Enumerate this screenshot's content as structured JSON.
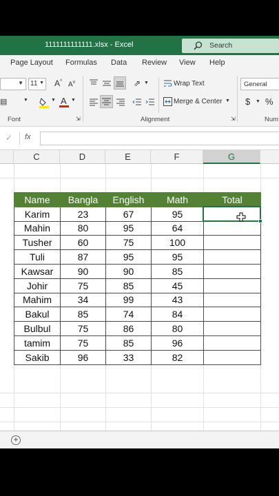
{
  "window": {
    "title": "1111111111111.xlsx  -  Excel"
  },
  "search": {
    "label": "Search"
  },
  "ribbon": {
    "menus": [
      "Page Layout",
      "Formulas",
      "Data",
      "Review",
      "View",
      "Help"
    ],
    "font_size": "11",
    "wrap_text": "Wrap Text",
    "merge_center": "Merge & Center",
    "number_format": "General",
    "currency": "$",
    "percent": "%",
    "groups": {
      "font": "Font",
      "alignment": "Alignment",
      "number": "Num"
    }
  },
  "formula_bar": {
    "fx": "fx",
    "value": ""
  },
  "columns": [
    "C",
    "D",
    "E",
    "F",
    "G"
  ],
  "selected_column": "G",
  "table": {
    "headers": [
      "Name",
      "Bangla",
      "English",
      "Math",
      "Total"
    ],
    "rows": [
      [
        "Karim",
        "23",
        "67",
        "95",
        ""
      ],
      [
        "Mahin",
        "80",
        "95",
        "64",
        ""
      ],
      [
        "Tusher",
        "60",
        "75",
        "100",
        ""
      ],
      [
        "Tuli",
        "87",
        "95",
        "95",
        ""
      ],
      [
        "Kawsar",
        "90",
        "90",
        "85",
        ""
      ],
      [
        "Johir",
        "75",
        "85",
        "45",
        ""
      ],
      [
        "Mahim",
        "34",
        "99",
        "43",
        ""
      ],
      [
        "Bakul",
        "85",
        "74",
        "84",
        ""
      ],
      [
        "Bulbul",
        "75",
        "86",
        "80",
        ""
      ],
      [
        "tamim",
        "75",
        "85",
        "96",
        ""
      ],
      [
        "Sakib",
        "96",
        "33",
        "82",
        ""
      ]
    ]
  },
  "sheet_tabs": {
    "add_label": "+"
  },
  "colors": {
    "excel_green": "#217346",
    "header_fill": "#548235"
  }
}
